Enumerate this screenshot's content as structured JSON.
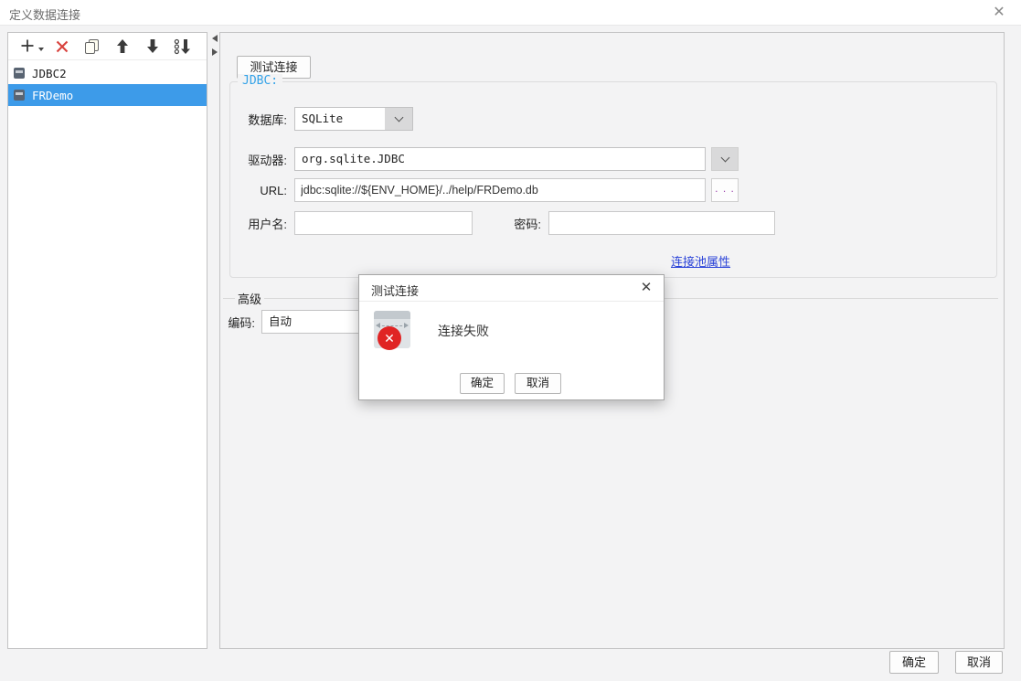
{
  "window": {
    "title": "定义数据连接",
    "close_glyph": "✕"
  },
  "sidebar": {
    "toolbar_icons": [
      "add-icon",
      "delete-icon",
      "copy-icon",
      "move-up-icon",
      "move-down-icon",
      "sort-icon"
    ],
    "items": [
      {
        "label": "JDBC2",
        "selected": false
      },
      {
        "label": "FRDemo",
        "selected": true
      }
    ]
  },
  "main": {
    "test_button": "测试连接",
    "jdbc_group": {
      "title": "JDBC:",
      "database_label": "数据库:",
      "database_value": "SQLite",
      "driver_label": "驱动器:",
      "driver_value": "org.sqlite.JDBC",
      "url_label": "URL:",
      "url_value": "jdbc:sqlite://${ENV_HOME}/../help/FRDemo.db",
      "browse_label": ". . .",
      "username_label": "用户名:",
      "username_value": "",
      "password_label": "密码:",
      "password_value": "",
      "pool_link": "连接池属性"
    },
    "advanced": {
      "title": "高级",
      "encoding_label": "编码:",
      "encoding_value": "自动"
    }
  },
  "dialog": {
    "title": "测试连接",
    "close_glyph": "✕",
    "message": "连接失败",
    "ok": "确定",
    "cancel": "取消",
    "error_badge_glyph": "✕"
  },
  "footer": {
    "ok": "确定",
    "cancel": "取消"
  },
  "colors": {
    "selection_blue": "#3d9be9",
    "group_title_blue": "#35a3e8",
    "link_blue": "#2b43d8",
    "delete_red": "#d8413c",
    "error_red": "#e02424"
  }
}
